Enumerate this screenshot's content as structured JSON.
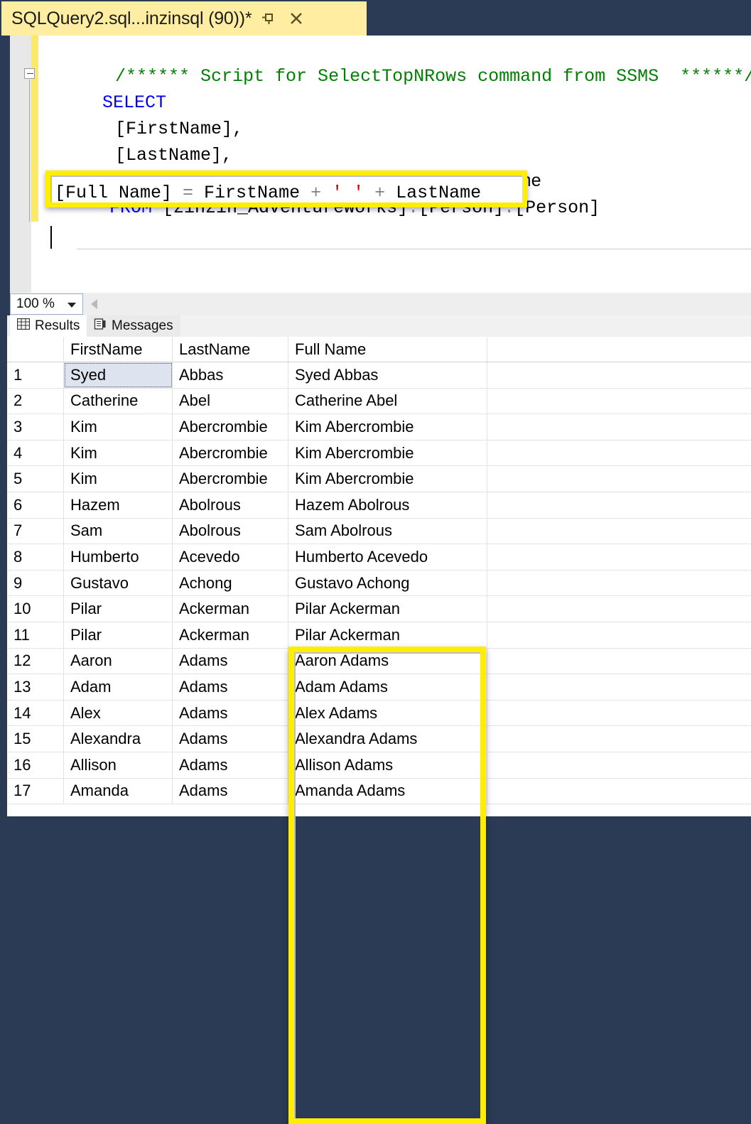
{
  "titlebar": {
    "tab_title": "SQLQuery2.sql...inzinsql (90))*",
    "pin_icon": "pin-icon",
    "close_icon": "close-icon"
  },
  "editor": {
    "lines": [
      {
        "indent": 18,
        "segments": [
          {
            "text": "/****** Script for SelectTopNRows command from SSMS  ******/",
            "cls": "cmt"
          }
        ]
      },
      {
        "indent": 0,
        "segments": [
          {
            "text": "SELECT",
            "cls": "kw"
          }
        ]
      },
      {
        "indent": 18,
        "segments": [
          {
            "text": "[FirstName],",
            "cls": ""
          }
        ]
      },
      {
        "indent": 18,
        "segments": [
          {
            "text": "[LastName],",
            "cls": ""
          }
        ]
      },
      {
        "indent": 18,
        "segments": [
          {
            "text": "[Full Name] = FirstName + ' ' + LastName",
            "cls": ""
          }
        ]
      },
      {
        "indent": 10,
        "segments": [
          {
            "text": "FROM ",
            "cls": "kw"
          },
          {
            "text": "[zinzin_AdventureWorks]",
            "cls": ""
          },
          {
            "text": ".",
            "cls": "punct"
          },
          {
            "text": "[Person]",
            "cls": ""
          },
          {
            "text": ".",
            "cls": "punct"
          },
          {
            "text": "[Person]",
            "cls": ""
          }
        ]
      }
    ],
    "highlighted_line": {
      "col_alias": "[Full Name]",
      "equals": " = ",
      "first": "FirstName",
      "plus1": " + ",
      "space_literal": "' '",
      "plus2": " + ",
      "last": "LastName"
    },
    "annotation_color": "#ffee00"
  },
  "statusbar": {
    "zoom_value": "100 %",
    "zoom_caret_icon": "chevron-down-icon",
    "scroll_left_icon": "scroll-left-arrow-icon"
  },
  "results": {
    "tabs": [
      {
        "label": "Results",
        "icon": "grid-icon",
        "active": true
      },
      {
        "label": "Messages",
        "icon": "document-icon",
        "active": false
      }
    ],
    "columns": [
      "",
      "FirstName",
      "LastName",
      "Full Name"
    ],
    "selected_cell": {
      "row": 1,
      "column": "FirstName",
      "value": "Syed"
    },
    "rows": [
      {
        "n": "1",
        "first": "Syed",
        "last": "Abbas",
        "full": "Syed Abbas"
      },
      {
        "n": "2",
        "first": "Catherine",
        "last": "Abel",
        "full": "Catherine Abel"
      },
      {
        "n": "3",
        "first": "Kim",
        "last": "Abercrombie",
        "full": "Kim Abercrombie"
      },
      {
        "n": "4",
        "first": "Kim",
        "last": "Abercrombie",
        "full": "Kim Abercrombie"
      },
      {
        "n": "5",
        "first": "Kim",
        "last": "Abercrombie",
        "full": "Kim Abercrombie"
      },
      {
        "n": "6",
        "first": "Hazem",
        "last": "Abolrous",
        "full": "Hazem Abolrous"
      },
      {
        "n": "7",
        "first": "Sam",
        "last": "Abolrous",
        "full": "Sam Abolrous"
      },
      {
        "n": "8",
        "first": "Humberto",
        "last": "Acevedo",
        "full": "Humberto Acevedo"
      },
      {
        "n": "9",
        "first": "Gustavo",
        "last": "Achong",
        "full": "Gustavo Achong"
      },
      {
        "n": "10",
        "first": "Pilar",
        "last": "Ackerman",
        "full": "Pilar Ackerman"
      },
      {
        "n": "11",
        "first": "Pilar",
        "last": "Ackerman",
        "full": "Pilar Ackerman"
      },
      {
        "n": "12",
        "first": "Aaron",
        "last": "Adams",
        "full": "Aaron Adams"
      },
      {
        "n": "13",
        "first": "Adam",
        "last": "Adams",
        "full": "Adam Adams"
      },
      {
        "n": "14",
        "first": "Alex",
        "last": "Adams",
        "full": "Alex Adams"
      },
      {
        "n": "15",
        "first": "Alexandra",
        "last": "Adams",
        "full": "Alexandra Adams"
      },
      {
        "n": "16",
        "first": "Allison",
        "last": "Adams",
        "full": "Allison Adams"
      },
      {
        "n": "17",
        "first": "Amanda",
        "last": "Adams",
        "full": "Amanda Adams"
      }
    ]
  },
  "colors": {
    "chrome": "#2b3a55",
    "active_tab": "#ffeda1",
    "annotation": "#ffee00",
    "keyword": "#0000ff",
    "comment": "#008000",
    "string": "#cc0000",
    "selection": "#dde3ef"
  }
}
